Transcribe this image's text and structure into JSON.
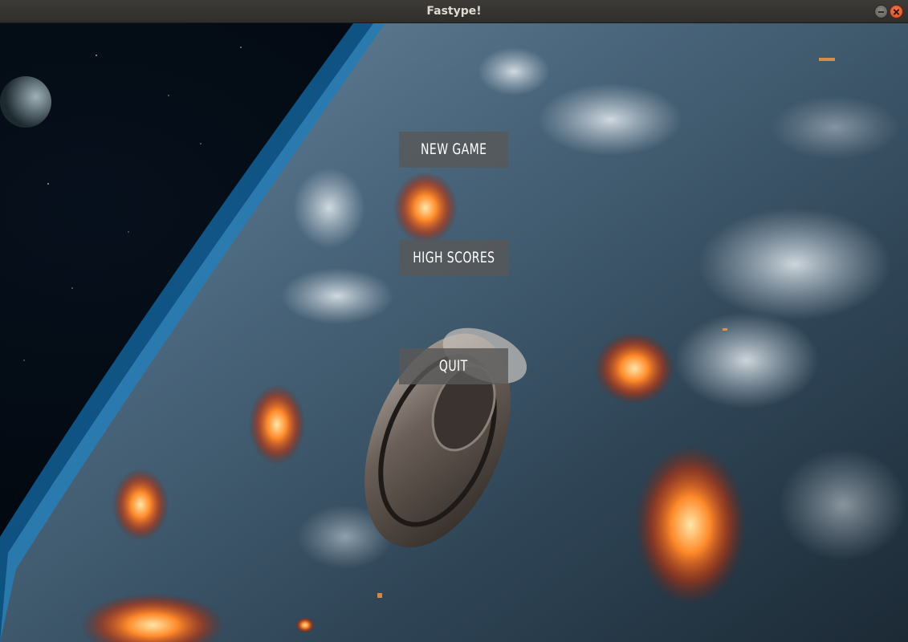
{
  "window": {
    "title": "Fastype!"
  },
  "menu": {
    "new_game": "NEW GAME",
    "high_scores": "HIGH SCORES",
    "quit": "QUIT"
  },
  "colors": {
    "titlebar": "#3c3b37",
    "close_button": "#e95420",
    "menu_button_bg": "#585858",
    "menu_button_text": "#ffffff"
  },
  "icons": {
    "minimize": "minimize-icon",
    "close": "close-icon"
  }
}
